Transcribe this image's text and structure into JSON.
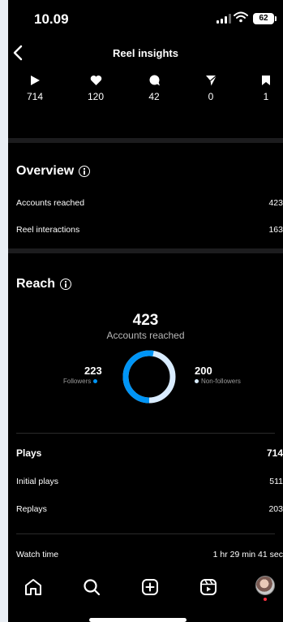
{
  "status": {
    "time": "10.09",
    "battery": "62"
  },
  "nav": {
    "title": "Reel insights"
  },
  "stats": {
    "plays": "714",
    "likes": "120",
    "comments": "42",
    "shares": "0",
    "saves": "1"
  },
  "overview": {
    "title": "Overview",
    "accounts_reached_label": "Accounts reached",
    "accounts_reached_value": "423",
    "interactions_label": "Reel interactions",
    "interactions_value": "163"
  },
  "reach": {
    "title": "Reach",
    "total": "423",
    "total_label": "Accounts reached",
    "followers_value": "223",
    "followers_label": "Followers",
    "nonfollowers_value": "200",
    "nonfollowers_label": "Non-followers",
    "followers_fraction": 0.527
  },
  "plays": {
    "title": "Plays",
    "total": "714",
    "initial_label": "Initial plays",
    "initial_value": "511",
    "replays_label": "Replays",
    "replays_value": "203"
  },
  "watch": {
    "label": "Watch time",
    "value": "1 hr 29 min 41 sec"
  },
  "tabs": [
    "home-icon",
    "search-icon",
    "create-icon",
    "reels-icon",
    "profile-avatar"
  ],
  "colors": {
    "accent": "#0095f6",
    "light_segment": "#d9ecff",
    "background": "#000000"
  }
}
